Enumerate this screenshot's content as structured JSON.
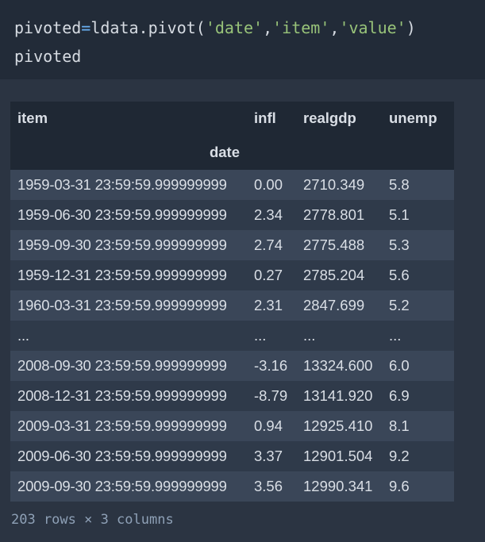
{
  "code": {
    "line1_tokens": [
      {
        "text": "pivoted",
        "kind": "plain"
      },
      {
        "text": "=",
        "kind": "op"
      },
      {
        "text": "ldata.pivot(",
        "kind": "plain"
      },
      {
        "text": "'date'",
        "kind": "str"
      },
      {
        "text": ",",
        "kind": "plain"
      },
      {
        "text": "'item'",
        "kind": "str"
      },
      {
        "text": ",",
        "kind": "plain"
      },
      {
        "text": "'value'",
        "kind": "str"
      },
      {
        "text": ")",
        "kind": "plain"
      }
    ],
    "line2": "pivoted"
  },
  "table": {
    "columns_name": "item",
    "index_name": "date",
    "columns": [
      "infl",
      "realgdp",
      "unemp"
    ],
    "rows": [
      {
        "date": "1959-03-31 23:59:59.999999999",
        "infl": "0.00",
        "realgdp": "2710.349",
        "unemp": "5.8"
      },
      {
        "date": "1959-06-30 23:59:59.999999999",
        "infl": "2.34",
        "realgdp": "2778.801",
        "unemp": "5.1"
      },
      {
        "date": "1959-09-30 23:59:59.999999999",
        "infl": "2.74",
        "realgdp": "2775.488",
        "unemp": "5.3"
      },
      {
        "date": "1959-12-31 23:59:59.999999999",
        "infl": "0.27",
        "realgdp": "2785.204",
        "unemp": "5.6"
      },
      {
        "date": "1960-03-31 23:59:59.999999999",
        "infl": "2.31",
        "realgdp": "2847.699",
        "unemp": "5.2"
      },
      {
        "date": "...",
        "infl": "...",
        "realgdp": "...",
        "unemp": "..."
      },
      {
        "date": "2008-09-30 23:59:59.999999999",
        "infl": "-3.16",
        "realgdp": "13324.600",
        "unemp": "6.0"
      },
      {
        "date": "2008-12-31 23:59:59.999999999",
        "infl": "-8.79",
        "realgdp": "13141.920",
        "unemp": "6.9"
      },
      {
        "date": "2009-03-31 23:59:59.999999999",
        "infl": "0.94",
        "realgdp": "12925.410",
        "unemp": "8.1"
      },
      {
        "date": "2009-06-30 23:59:59.999999999",
        "infl": "3.37",
        "realgdp": "12901.504",
        "unemp": "9.2"
      },
      {
        "date": "2009-09-30 23:59:59.999999999",
        "infl": "3.56",
        "realgdp": "12990.341",
        "unemp": "9.6"
      }
    ]
  },
  "shape_info": "203 rows × 3 columns",
  "colors": {
    "background": "#2b3442",
    "code_background": "#222b38",
    "header_background": "#1f2834",
    "row_odd": "#3a4658",
    "row_even": "#2f3a4a",
    "string_token": "#98c379",
    "operator_token": "#6ab0f3"
  }
}
